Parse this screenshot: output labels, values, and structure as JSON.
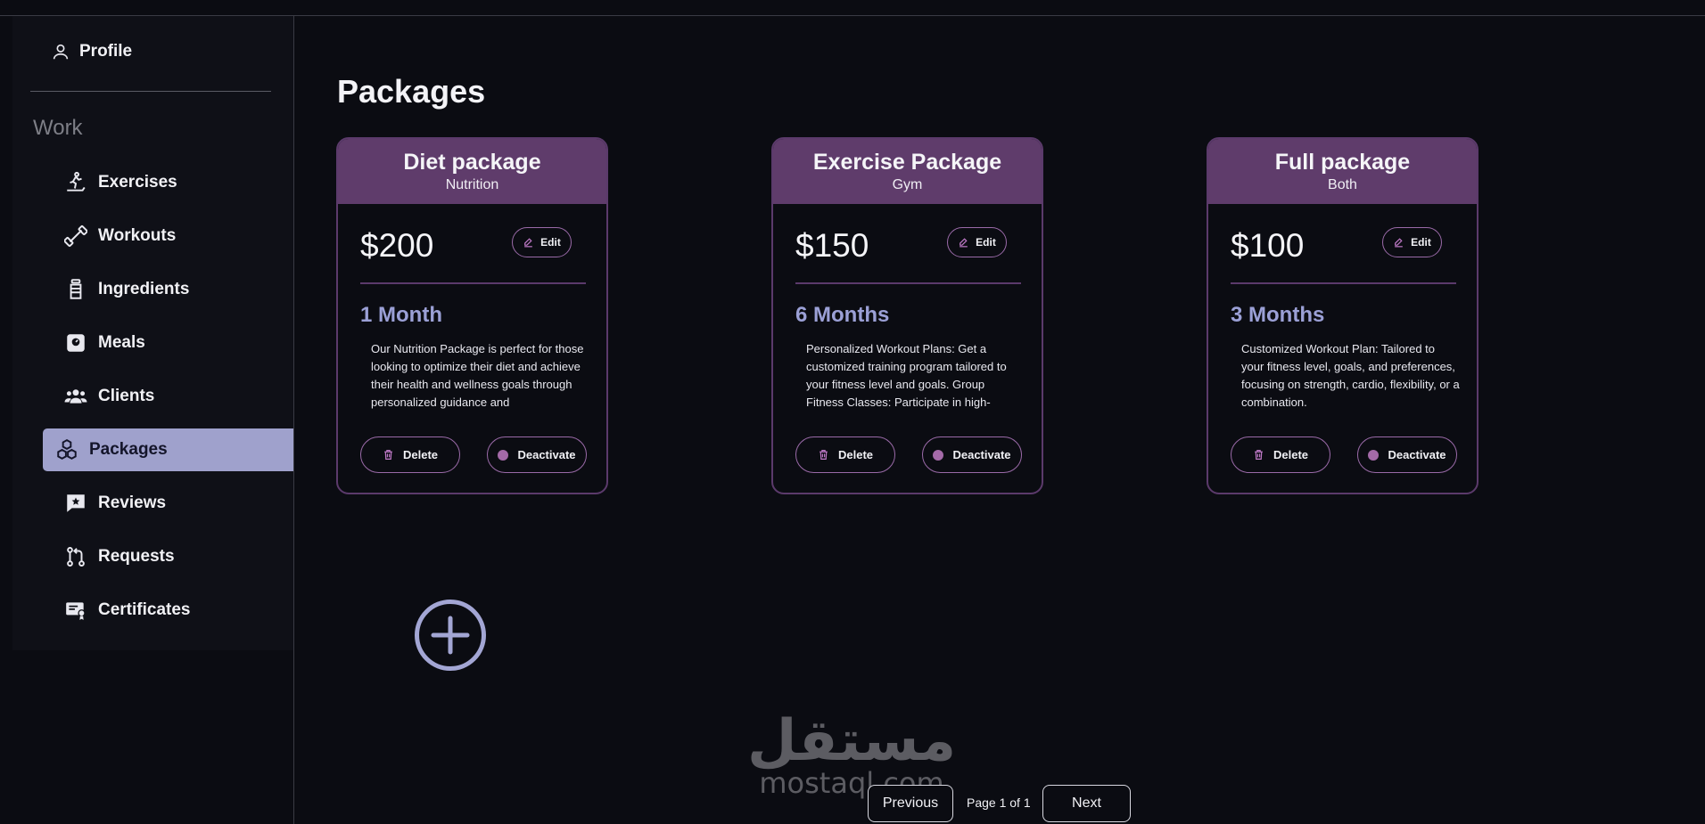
{
  "sidebar": {
    "profile_label": "Profile",
    "section_heading": "Work",
    "items": [
      {
        "label": "Exercises",
        "icon": "treadmill-icon"
      },
      {
        "label": "Workouts",
        "icon": "dumbbell-icon"
      },
      {
        "label": "Ingredients",
        "icon": "bottle-icon"
      },
      {
        "label": "Meals",
        "icon": "scale-icon"
      },
      {
        "label": "Clients",
        "icon": "users-icon"
      },
      {
        "label": "Packages",
        "icon": "boxes-icon",
        "active": true
      },
      {
        "label": "Reviews",
        "icon": "review-icon"
      },
      {
        "label": "Requests",
        "icon": "pull-request-icon"
      },
      {
        "label": "Certificates",
        "icon": "certificate-icon"
      }
    ]
  },
  "main": {
    "title": "Packages",
    "cards": [
      {
        "title": "Diet package",
        "subtitle": "Nutrition",
        "price": "$200",
        "edit_label": "Edit",
        "duration": "1 Month",
        "description": "Our Nutrition Package is perfect for those looking to optimize their diet and achieve their health and wellness goals through personalized guidance and",
        "delete_label": "Delete",
        "deactivate_label": "Deactivate"
      },
      {
        "title": "Exercise Package",
        "subtitle": "Gym",
        "price": "$150",
        "edit_label": "Edit",
        "duration": "6 Months",
        "description": "Personalized Workout Plans: Get a customized training program tailored to your fitness level and goals. Group Fitness Classes: Participate in high-",
        "delete_label": "Delete",
        "deactivate_label": "Deactivate"
      },
      {
        "title": "Full package",
        "subtitle": "Both",
        "price": "$100",
        "edit_label": "Edit",
        "duration": "3 Months",
        "description": "Customized Workout Plan: Tailored to your fitness level, goals, and preferences, focusing on strength, cardio, flexibility, or a combination.",
        "delete_label": "Delete",
        "deactivate_label": "Deactivate"
      }
    ],
    "add_icon": "plus-circle-icon"
  },
  "pagination": {
    "previous_label": "Previous",
    "info": "Page 1 of 1",
    "next_label": "Next"
  },
  "watermark": {
    "arabic": "مستقل",
    "latin": "mostaql.com"
  },
  "colors": {
    "background": "#0b0c12",
    "card_header": "#5f3c6b",
    "card_border": "#5b3a6b",
    "accent_blue": "#9ba0d6",
    "active_nav": "#9fa1cc",
    "deactivate_dot": "#a46aa8"
  }
}
